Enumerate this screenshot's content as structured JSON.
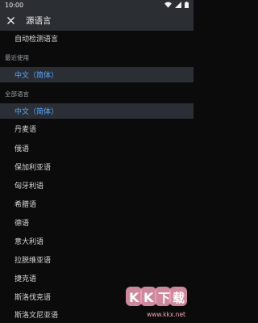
{
  "status_bar": {
    "time": "10:00"
  },
  "header": {
    "title": "源语言",
    "close_icon": "close-icon"
  },
  "auto_detect": {
    "label": "自动检测语言"
  },
  "sections": {
    "recent": {
      "title": "最近使用",
      "items": [
        "中文（简体）"
      ]
    },
    "all": {
      "title": "全部语言",
      "items": [
        "中文（简体）",
        "丹麦语",
        "俄语",
        "保加利亚语",
        "匈牙利语",
        "希腊语",
        "德语",
        "意大利语",
        "拉脱维亚语",
        "捷克语",
        "斯洛伐克语",
        "斯洛文尼亚语"
      ]
    }
  },
  "watermark": {
    "logo_text": "KKX下载",
    "url": "www.kkx.net"
  },
  "colors": {
    "accent": "#58a6ff",
    "toolbar": "#2b2e33",
    "background": "#0b0b0c",
    "selected_row": "#2b2f35",
    "watermark": "#f0a0b5"
  }
}
